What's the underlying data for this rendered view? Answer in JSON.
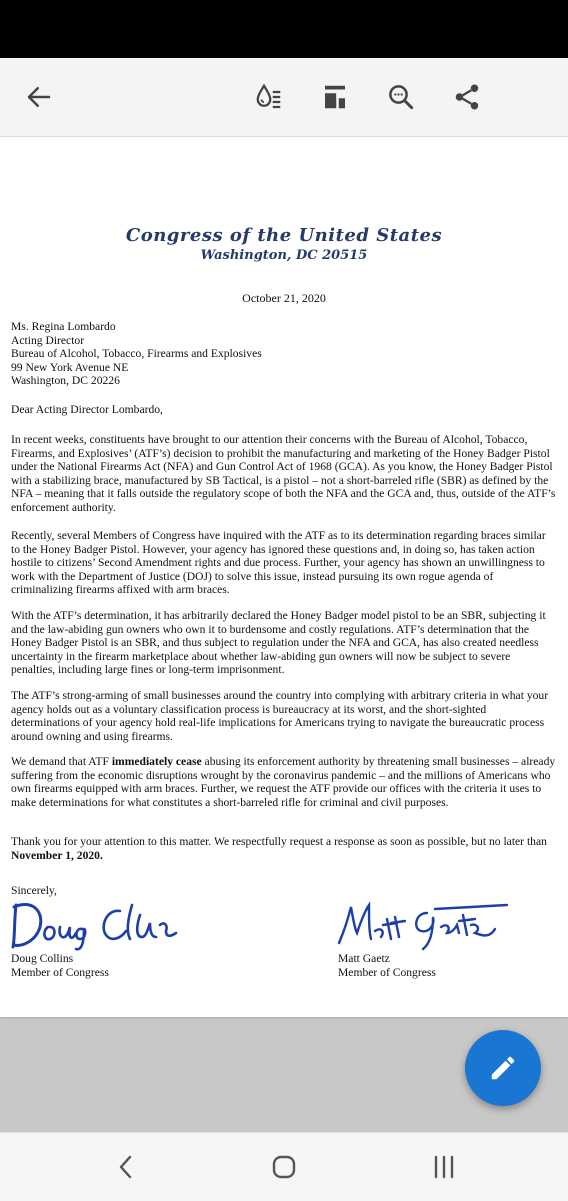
{
  "letterhead": {
    "title": "Congress of the United States",
    "subtitle": "Washington, DC 20515"
  },
  "letter": {
    "date": "October 21, 2020",
    "address_lines": [
      "Ms. Regina Lombardo",
      "Acting Director",
      "Bureau of Alcohol, Tobacco, Firearms and Explosives",
      "99 New York Avenue NE",
      "Washington, DC 20226"
    ],
    "salutation": "Dear Acting Director Lombardo,",
    "p1": "In recent weeks, constituents have brought to our attention their concerns with the Bureau of Alcohol, Tobacco, Firearms, and Explosives’ (ATF’s) decision to prohibit the manufacturing and marketing of the Honey Badger Pistol under the National Firearms Act (NFA) and Gun Control Act of 1968 (GCA). As you know, the Honey Badger Pistol with a stabilizing brace, manufactured by SB Tactical, is a pistol – not a short-barreled rifle (SBR) as defined by the NFA – meaning that it falls outside the regulatory scope of both the NFA and the GCA and, thus, outside of the ATF’s enforcement authority.",
    "p2": "Recently, several Members of Congress have inquired with the ATF as to its determination regarding braces similar to the Honey Badger Pistol. However, your agency has ignored these questions and, in doing so, has taken action hostile to citizens’ Second Amendment rights and due process. Further, your agency has shown an unwillingness to work with the Department of Justice (DOJ) to solve this issue, instead pursuing its own rogue agenda of criminalizing firearms affixed with arm braces.",
    "p3": "With the ATF’s determination, it has arbitrarily declared the Honey Badger model pistol to be an SBR, subjecting it and the law-abiding gun owners who own it to burdensome and costly regulations. ATF’s determination that the Honey Badger Pistol is an SBR, and thus subject to regulation under the NFA and GCA, has also created needless uncertainty in the firearm marketplace about whether law-abiding gun owners will now be subject to severe penalties, including large fines or long-term imprisonment.",
    "p4": "The ATF’s strong-arming of small businesses around the country into complying with arbitrary criteria in what your agency holds out as a voluntary classification process is bureaucracy at its worst, and the short-sighted determinations of your agency hold real-life implications for Americans trying to navigate the bureaucratic process around owning and using firearms.",
    "p5_before": "We demand that ATF ",
    "p5_bold": "immediately cease",
    "p5_after": " abusing its enforcement authority by threatening small businesses – already suffering from the economic disruptions wrought by the coronavirus pandemic – and the millions of Americans who own firearms equipped with arm braces. Further, we request the ATF provide our offices with the criteria it uses to make determinations for what constitutes a short-barreled rifle for criminal and civil purposes.",
    "p6_before": "Thank you for your attention to this matter. We respectfully request a response as soon as possible, but no later than ",
    "p6_bold": "November 1, 2020.",
    "closing": "Sincerely,",
    "signer_left": {
      "name": "Doug Collins",
      "title": "Member of Congress"
    },
    "signer_right": {
      "name": "Matt Gaetz",
      "title": "Member of Congress"
    }
  },
  "icons": {
    "back": "arrow-left-icon",
    "reading_mode": "drop-lines-icon",
    "page_view": "page-layout-icon",
    "search": "search-icon",
    "share": "share-icon",
    "fab": "pencil-icon"
  },
  "colors": {
    "letterhead": "#253a6b",
    "signature": "#1e3ea8",
    "fab": "#1976d2"
  }
}
